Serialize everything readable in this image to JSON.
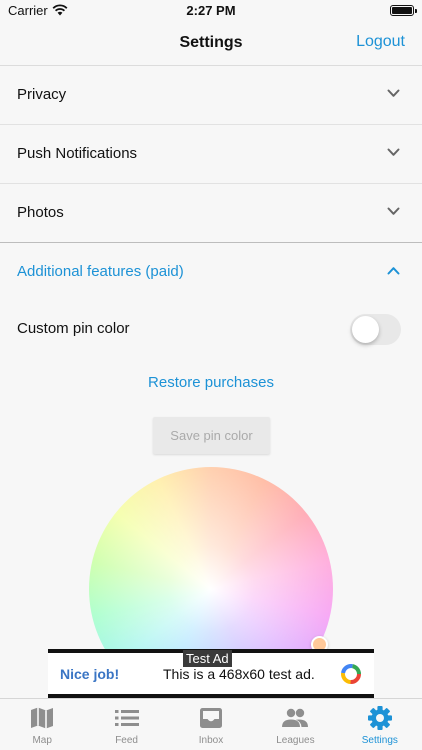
{
  "status_bar": {
    "carrier": "Carrier",
    "time": "2:27 PM"
  },
  "nav": {
    "title": "Settings",
    "logout": "Logout"
  },
  "sections": [
    {
      "label": "Privacy"
    },
    {
      "label": "Push Notifications"
    },
    {
      "label": "Photos"
    },
    {
      "label": "Additional features (paid)"
    }
  ],
  "custom_pin": {
    "label": "Custom pin color",
    "enabled": false
  },
  "restore_label": "Restore purchases",
  "save_label": "Save pin color",
  "ad": {
    "tag": "Test Ad",
    "headline": "Nice job!",
    "body": "This is a 468x60 test ad."
  },
  "tabs": [
    {
      "label": "Map",
      "icon": "map-icon"
    },
    {
      "label": "Feed",
      "icon": "list-icon"
    },
    {
      "label": "Inbox",
      "icon": "inbox-icon"
    },
    {
      "label": "Leagues",
      "icon": "people-icon"
    },
    {
      "label": "Settings",
      "icon": "gear-icon",
      "active": true
    }
  ],
  "colors": {
    "accent": "#1d92d6",
    "inactive": "#8e8e8e",
    "selected_pin": "#ffc99a"
  }
}
